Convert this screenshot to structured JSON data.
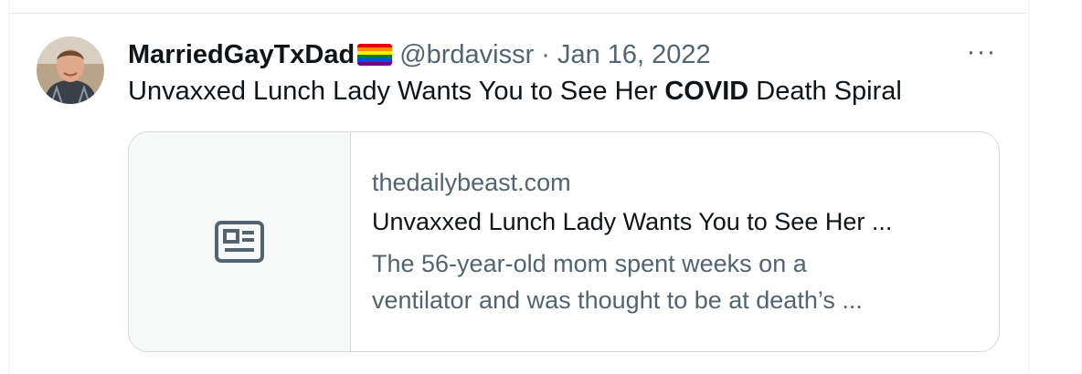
{
  "tweet": {
    "author_name": "MarriedGayTxDad",
    "handle": "@brdavissr",
    "separator": "·",
    "date": "Jan 16, 2022",
    "more_label": "···",
    "text_before": "Unvaxxed Lunch Lady Wants You to See Her ",
    "text_bold": "COVID",
    "text_after": " Death Spiral"
  },
  "card": {
    "domain": "thedailybeast.com",
    "title": "Unvaxxed Lunch Lady Wants You to See Her ...",
    "description_line1": "The 56-year-old mom spent weeks on a",
    "description_line2": "ventilator and was thought to be at death’s ...",
    "icon": "news-article-icon"
  },
  "icons": {
    "avatar": "profile-photo",
    "flag": "rainbow-flag-icon",
    "more": "more-options-icon"
  },
  "colors": {
    "text_primary": "#0f1419",
    "text_secondary": "#536471",
    "border": "#cfd9de",
    "media_bg": "#f7f9f9"
  }
}
